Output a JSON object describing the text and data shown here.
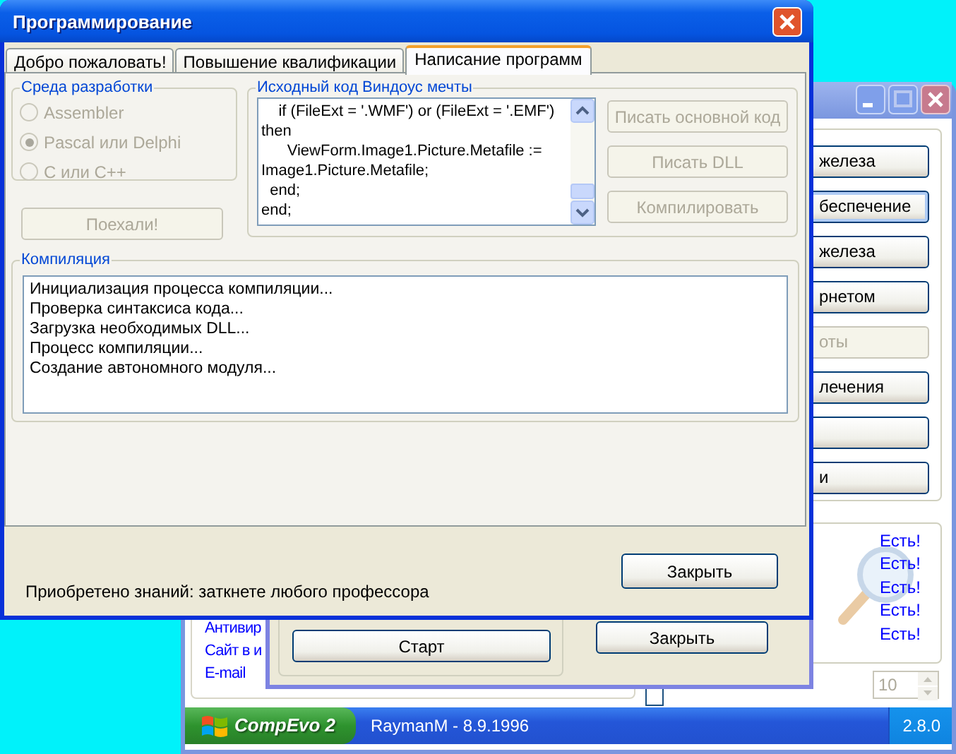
{
  "main_window": {
    "menu_buttons": [
      {
        "label": "железа",
        "disabled": false,
        "focused": false
      },
      {
        "label": "беспечение",
        "disabled": false,
        "focused": true
      },
      {
        "label": "железа",
        "disabled": false,
        "focused": false
      },
      {
        "label": "рнетом",
        "disabled": false,
        "focused": false
      },
      {
        "label": "оты",
        "disabled": true,
        "focused": false
      },
      {
        "label": "лечения",
        "disabled": false,
        "focused": false
      },
      {
        "disabled": false,
        "focused": false
      },
      {
        "label": "и",
        "disabled": false,
        "focused": false
      }
    ],
    "status_links": [
      "Есть!",
      "Есть!",
      "Есть!",
      "Есть!",
      "Есть!"
    ],
    "links": [
      "Антивир",
      "Сайт в и",
      "E-mail"
    ],
    "transparency": {
      "checked": false
    },
    "spinner": {
      "value": "10",
      "disabled": true
    },
    "status_bar": {
      "start_label": "CompEvo 2",
      "user_label": "RaymanM - 8.9.1996",
      "version": "2.8.0"
    }
  },
  "dialog": {
    "start_button": {
      "label": "Старт"
    },
    "close_button": {
      "label": "Закрыть"
    }
  },
  "program_window": {
    "title": "Программирование",
    "tabs": [
      {
        "label": "Добро пожаловать!",
        "selected": false
      },
      {
        "label": "Повышение квалификации",
        "selected": false
      },
      {
        "label": "Написание программ",
        "selected": true
      }
    ],
    "environment": {
      "title": "Среда разработки",
      "options": [
        {
          "label": "Assembler",
          "selected": false,
          "disabled": true
        },
        {
          "label": "Pascal или Delphi",
          "selected": true,
          "disabled": true
        },
        {
          "label": "C или C++",
          "selected": false,
          "disabled": true
        }
      ]
    },
    "go_button": {
      "label": "Поехали!",
      "disabled": true
    },
    "source": {
      "title": "Исходный код Виндоус мечты",
      "lines": [
        "    if (FileExt = '.WMF') or (FileExt = '.EMF')",
        "then",
        "      ViewForm.Image1.Picture.Metafile :=",
        "Image1.Picture.Metafile;",
        "  end;",
        "end;"
      ]
    },
    "actions": [
      {
        "label": "Писать основной код",
        "disabled": true
      },
      {
        "label": "Писать DLL",
        "disabled": true
      },
      {
        "label": "Компилировать",
        "disabled": true
      }
    ],
    "compilation": {
      "title": "Компиляция",
      "lines": [
        "Инициализация процесса компиляции...",
        "Проверка синтаксиса кода...",
        "Загрузка необходимых DLL...",
        "Процесс компиляции...",
        "Создание автономного модуля..."
      ]
    },
    "knowledge": "Приобретено знаний: заткнете любого профессора",
    "close_button": {
      "label": "Закрыть",
      "disabled": false
    }
  }
}
